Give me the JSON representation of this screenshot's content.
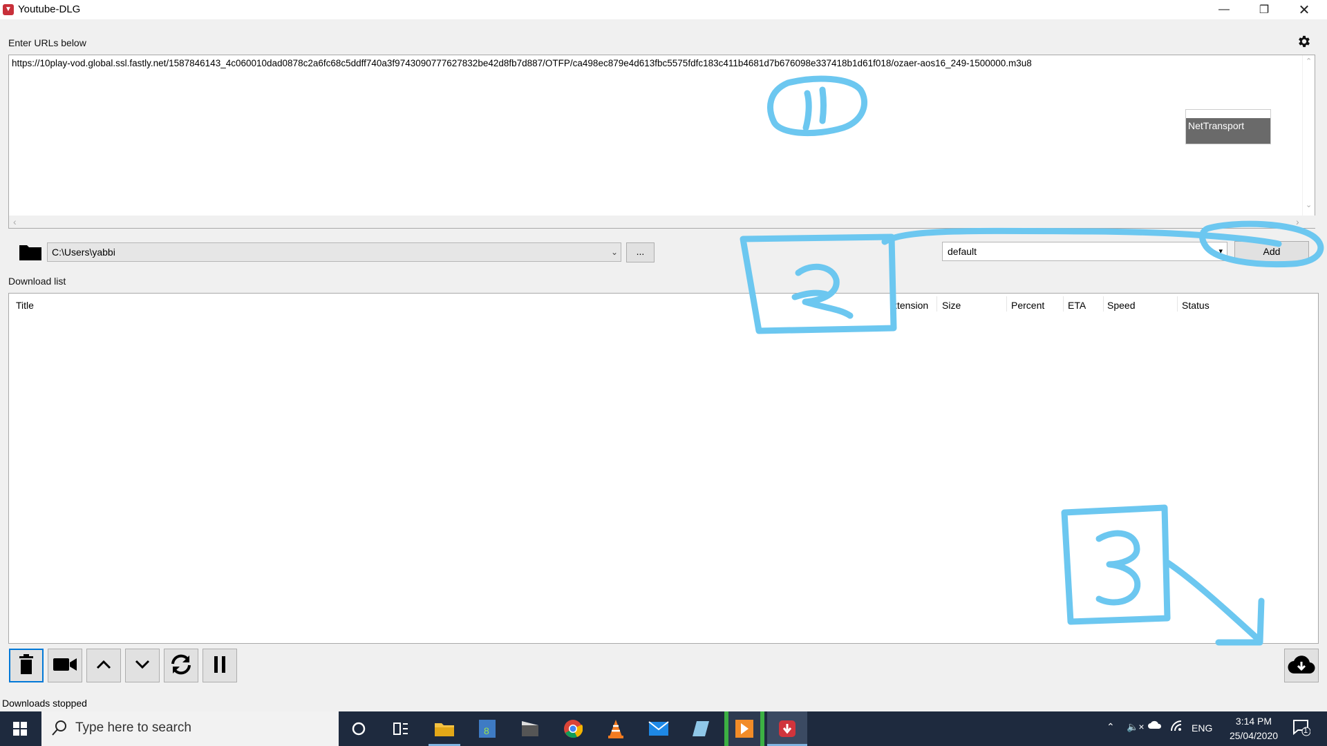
{
  "window": {
    "title": "Youtube-DLG",
    "app_icon": "youtube-dlg-icon"
  },
  "urls": {
    "label": "Enter URLs below",
    "content": "https://10play-vod.global.ssl.fastly.net/1587846143_4c060010dad0878c2a6fc68c5ddff740a3f9743090777627832be42d8fb7d887/OTFP/ca498ec879e4d613fbc5575fdfc183c411b4681d7b676098e337418b1d61f018/ozaer-aos16_249-1500000.m3u8"
  },
  "popup": {
    "label": "NetTransport"
  },
  "path": {
    "value": "C:\\Users\\yabbi",
    "browse_label": "..."
  },
  "format": {
    "value": "default",
    "add_label": "Add"
  },
  "download_list": {
    "label": "Download list",
    "columns": [
      "Title",
      "xtension",
      "Size",
      "Percent",
      "ETA",
      "Speed",
      "Status"
    ]
  },
  "status_bar": {
    "text": "Downloads stopped"
  },
  "taskbar": {
    "search_placeholder": "Type here to search",
    "language": "ENG",
    "time": "3:14 PM",
    "date": "25/04/2020",
    "notification_count": "1"
  },
  "annotations": {
    "circle_1": "1",
    "box_2": "2",
    "box_3": "3",
    "color": "#6cc7f0"
  },
  "colors": {
    "accent": "#0078d7",
    "taskbar": "#1e2a3e",
    "title_icon": "#c8303a"
  }
}
